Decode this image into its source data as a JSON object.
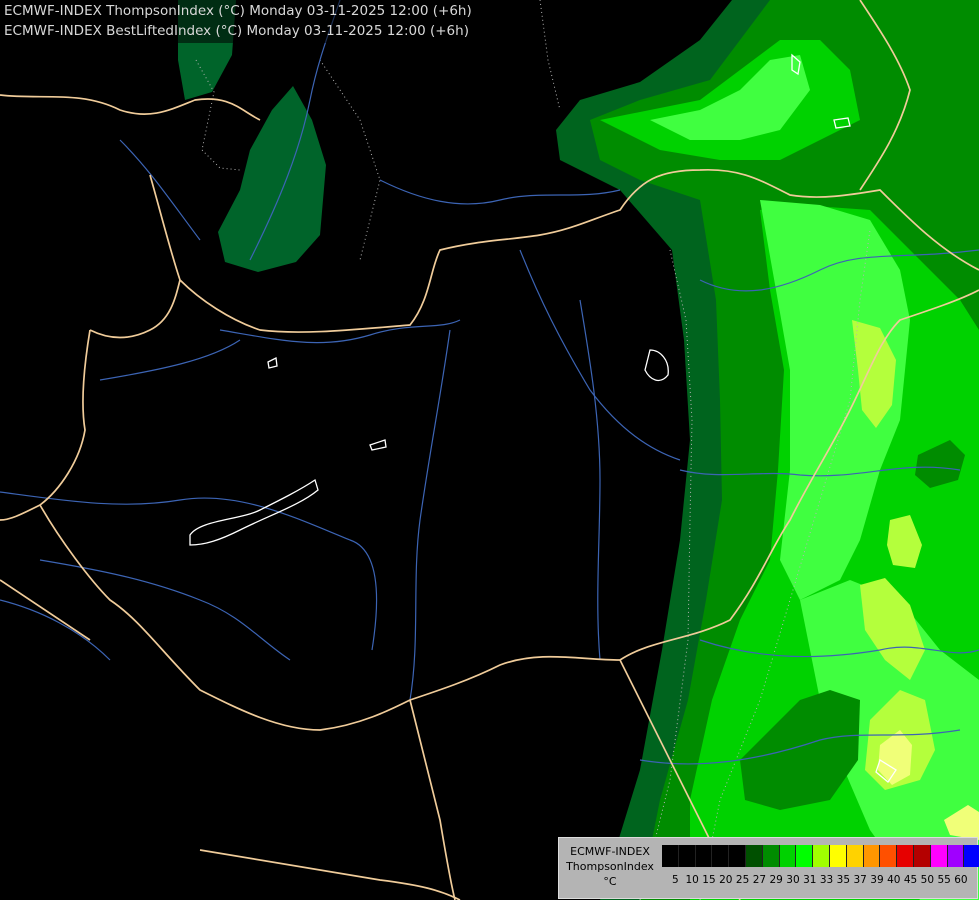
{
  "title": {
    "line1": "ECMWF-INDEX ThompsonIndex (°C) Monday 03-11-2025 12:00 (+6h)",
    "line2": "ECMWF-INDEX BestLiftedIndex (°C) Monday 03-11-2025 12:00 (+6h)"
  },
  "legend": {
    "label_line1": "ECMWF-INDEX",
    "label_line2": "ThompsonIndex",
    "label_line3": "°C",
    "swatches": [
      {
        "value": "",
        "color": "#000000"
      },
      {
        "value": "5",
        "color": "#000000"
      },
      {
        "value": "10",
        "color": "#000000"
      },
      {
        "value": "15",
        "color": "#000000"
      },
      {
        "value": "20",
        "color": "#000000"
      },
      {
        "value": "25",
        "color": "#005000"
      },
      {
        "value": "27",
        "color": "#008c00"
      },
      {
        "value": "29",
        "color": "#00d200"
      },
      {
        "value": "30",
        "color": "#00ff00"
      },
      {
        "value": "31",
        "color": "#a0ff00"
      },
      {
        "value": "33",
        "color": "#ffff00"
      },
      {
        "value": "35",
        "color": "#ffd200"
      },
      {
        "value": "37",
        "color": "#ff9600"
      },
      {
        "value": "39",
        "color": "#ff5000"
      },
      {
        "value": "40",
        "color": "#e60000"
      },
      {
        "value": "45",
        "color": "#b40000"
      },
      {
        "value": "50",
        "color": "#ff00ff"
      },
      {
        "value": "55",
        "color": "#a000ff"
      },
      {
        "value": "60",
        "color": "#0000ff"
      }
    ]
  },
  "map_colors": {
    "background": "#000000",
    "border": "#f0cc9a",
    "river": "#3c64b4",
    "lake_outline": "#ffffff",
    "dotted_contour": "#b4b4b4"
  }
}
